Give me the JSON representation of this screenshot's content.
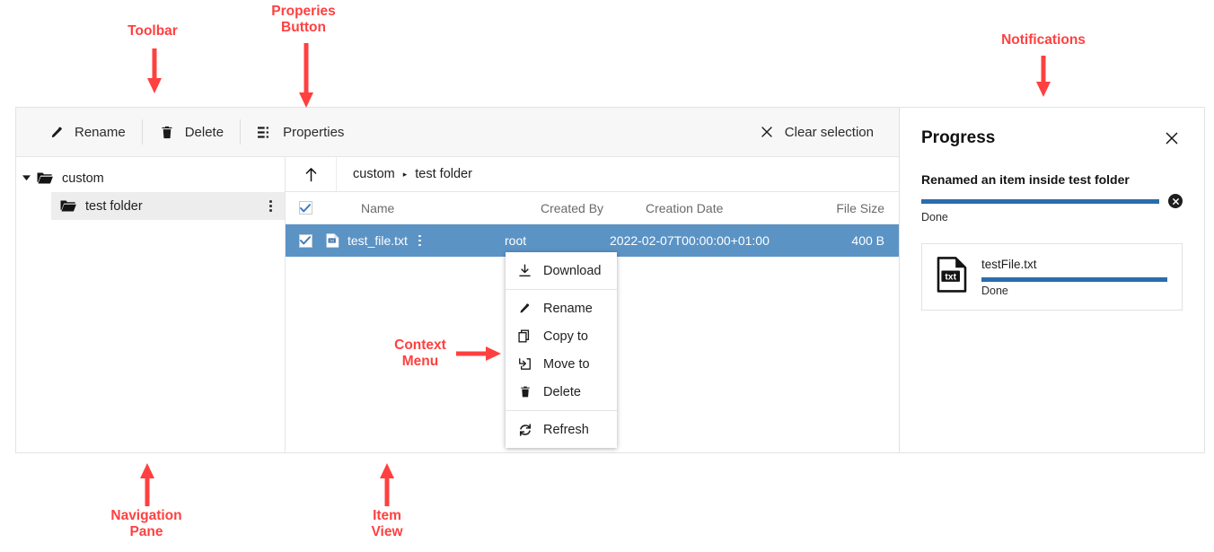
{
  "toolbar": {
    "buttons": [
      {
        "label": "Rename",
        "icon": "pencil-icon"
      },
      {
        "label": "Delete",
        "icon": "trash-icon"
      },
      {
        "label": "Properties",
        "icon": "details-list-icon"
      }
    ],
    "clear_selection": {
      "label": "Clear selection",
      "icon": "close-icon"
    }
  },
  "navigation": {
    "root": {
      "label": "custom",
      "expanded": true
    },
    "child": {
      "label": "test folder",
      "selected": true
    }
  },
  "breadcrumb": {
    "up_label": "Up",
    "separator": "▸",
    "items": [
      "custom",
      "test folder"
    ]
  },
  "table": {
    "columns": [
      "Name",
      "Created By",
      "Creation Date",
      "File Size"
    ],
    "header_checkbox_checked": true,
    "rows": [
      {
        "checked": true,
        "name": "test_file.txt",
        "created_by": "root",
        "creation_date": "2022-02-07T00:00:00+01:00",
        "file_size": "400 B",
        "icon": "txt-file-icon",
        "selected": true
      }
    ]
  },
  "context_menu": {
    "groups": [
      [
        {
          "label": "Download",
          "icon": "download-icon"
        }
      ],
      [
        {
          "label": "Rename",
          "icon": "pencil-icon"
        },
        {
          "label": "Copy to",
          "icon": "copy-icon"
        },
        {
          "label": "Move to",
          "icon": "move-icon"
        },
        {
          "label": "Delete",
          "icon": "trash-icon"
        }
      ],
      [
        {
          "label": "Refresh",
          "icon": "refresh-icon"
        }
      ]
    ]
  },
  "notifications": {
    "title": "Progress",
    "close_icon": "close-icon",
    "main_task": {
      "text": "Renamed an item inside test folder",
      "progress_percent": 100,
      "status": "Done",
      "cancel_icon": "cancel-circle-icon"
    },
    "items": [
      {
        "name": "testFile.txt",
        "icon": "txt-file-icon",
        "progress_percent": 100,
        "status": "Done"
      }
    ]
  },
  "annotations": [
    {
      "id": "toolbar",
      "text": "Toolbar"
    },
    {
      "id": "properties-button",
      "text": "Properies\nButton"
    },
    {
      "id": "notifications",
      "text": "Notifications"
    },
    {
      "id": "context-menu",
      "text": "Context\nMenu"
    },
    {
      "id": "navigation-pane",
      "text": "Navigation\nPane"
    },
    {
      "id": "item-view",
      "text": "Item\nView"
    }
  ],
  "colors": {
    "annotation": "#ff4040",
    "selection_row": "#5b93c5",
    "progress_fill": "#2b6cab",
    "toolbar_bg": "#f7f7f7"
  }
}
